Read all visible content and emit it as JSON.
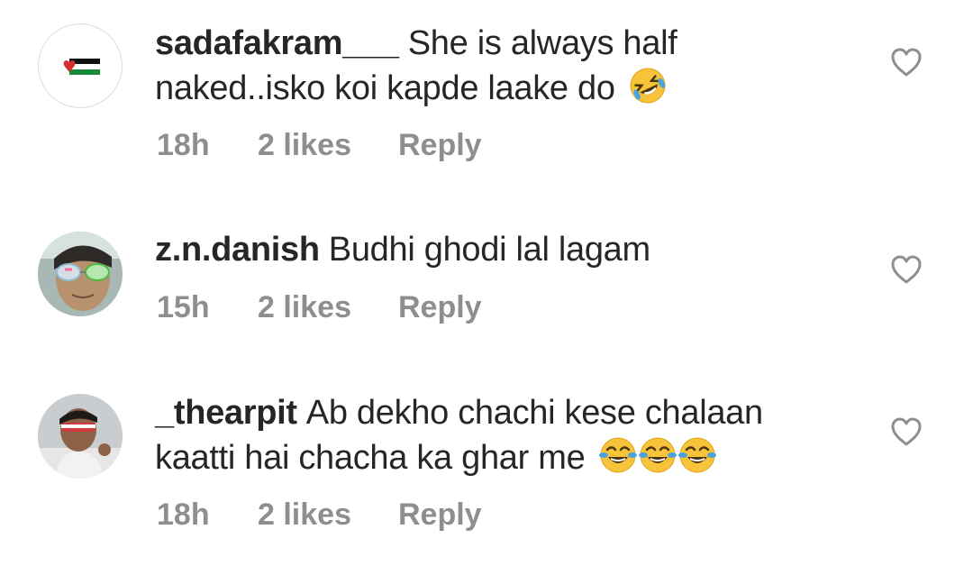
{
  "comments": [
    {
      "username": "sadafakram___",
      "text": "She is always half naked..isko koi kapde laake do",
      "emoji": [
        "rolling-on-floor-laughing"
      ],
      "time": "18h",
      "likes": "2 likes",
      "reply_label": "Reply",
      "avatar_icon": "palestine-flag-heart-icon"
    },
    {
      "username": "z.n.danish",
      "text": "Budhi ghodi lal lagam",
      "emoji": [],
      "time": "15h",
      "likes": "2 likes",
      "reply_label": "Reply",
      "avatar_icon": "profile-photo"
    },
    {
      "username": "_thearpit",
      "text": "Ab dekho chachi kese chalaan kaatti hai chacha ka ghar me",
      "emoji": [
        "face-with-tears-of-joy",
        "face-with-tears-of-joy",
        "face-with-tears-of-joy"
      ],
      "time": "18h",
      "likes": "2 likes",
      "reply_label": "Reply",
      "avatar_icon": "profile-photo"
    }
  ],
  "colors": {
    "text": "#262626",
    "meta": "#8e8e8e",
    "heart_outline": "#8e8e8e",
    "emoji_yellow": "#f6c33a",
    "emoji_tears": "#4aa3df"
  }
}
